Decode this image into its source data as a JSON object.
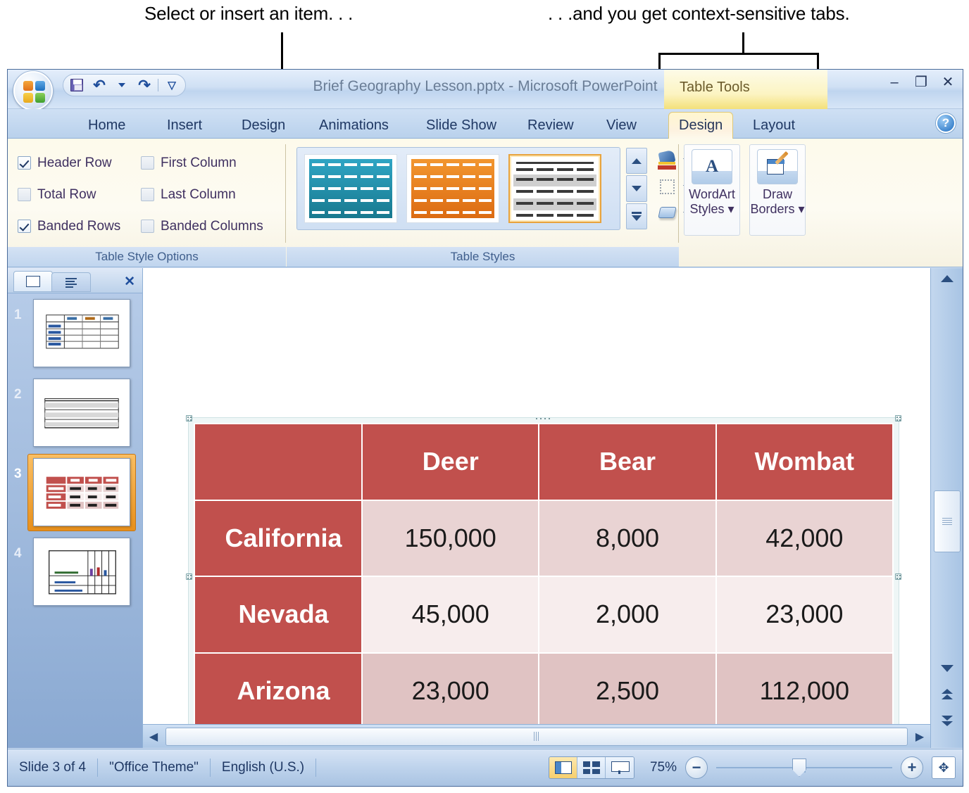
{
  "annotations": {
    "left_callout": "Select or insert an item. . .",
    "right_callout": ". . .and you get context-sensitive tabs."
  },
  "window": {
    "title": "Brief Geography Lesson.pptx - Microsoft PowerPoint",
    "contextual_group_label": "Table Tools",
    "office_button": "office-orb",
    "quick_access": [
      {
        "name": "save",
        "icon": "save-icon"
      },
      {
        "name": "undo",
        "icon": "undo-icon"
      },
      {
        "name": "undo-dropdown",
        "icon": "chevron-down-icon"
      },
      {
        "name": "redo",
        "icon": "redo-icon"
      },
      {
        "name": "customize-qat",
        "icon": "chevron-down-icon"
      }
    ],
    "controls": {
      "minimize": "–",
      "restore": "❐",
      "close": "✕"
    },
    "help": "?"
  },
  "tabs": {
    "main": [
      "Home",
      "Insert",
      "Design",
      "Animations",
      "Slide Show",
      "Review",
      "View"
    ],
    "contextual": [
      "Design",
      "Layout"
    ],
    "active": "Design"
  },
  "ribbon": {
    "groups": [
      {
        "label": "Table Style Options"
      },
      {
        "label": "Table Styles"
      }
    ],
    "table_style_options": [
      {
        "label": "Header Row",
        "checked": true
      },
      {
        "label": "First Column",
        "checked": false
      },
      {
        "label": "Total Row",
        "checked": false
      },
      {
        "label": "Last Column",
        "checked": false
      },
      {
        "label": "Banded Rows",
        "checked": true
      },
      {
        "label": "Banded Columns",
        "checked": false
      }
    ],
    "gallery": {
      "items": [
        {
          "name": "table-style-teal",
          "selected": false
        },
        {
          "name": "table-style-orange",
          "selected": false
        },
        {
          "name": "table-style-plain",
          "selected": true
        }
      ],
      "scroll": [
        "scroll-up",
        "scroll-down",
        "more-styles"
      ]
    },
    "style_commands": [
      {
        "name": "shading",
        "icon": "shading-icon"
      },
      {
        "name": "borders",
        "icon": "borders-icon"
      },
      {
        "name": "effects",
        "icon": "effects-icon"
      }
    ],
    "big_buttons": [
      {
        "line1": "WordArt",
        "line2": "Styles",
        "icon": "wordart-icon",
        "dropdown": true
      },
      {
        "line1": "Draw",
        "line2": "Borders",
        "icon": "draw-borders-icon",
        "dropdown": true
      }
    ]
  },
  "slides_pane": {
    "tabs": [
      {
        "name": "slides-tab",
        "icon": "slide-icon",
        "active": true
      },
      {
        "name": "outline-tab",
        "icon": "outline-icon",
        "active": false
      }
    ],
    "close_label": "✕",
    "thumbnails": [
      {
        "number": "1",
        "current": false
      },
      {
        "number": "2",
        "current": false
      },
      {
        "number": "3",
        "current": true
      },
      {
        "number": "4",
        "current": false
      }
    ]
  },
  "slide": {
    "table": {
      "header": [
        "",
        "Deer",
        "Bear",
        "Wombat"
      ],
      "rows": [
        {
          "label": "California",
          "values": [
            "150,000",
            "8,000",
            "42,000"
          ]
        },
        {
          "label": "Nevada",
          "values": [
            "45,000",
            "2,000",
            "23,000"
          ]
        },
        {
          "label": "Arizona",
          "values": [
            "23,000",
            "2,500",
            "112,000"
          ]
        }
      ],
      "header_fill": "#c1504d",
      "first_column_fill": "#c1504d",
      "band_a_fill": "#e9d3d3",
      "band_b_fill": "#f7eded",
      "band_c_fill": "#e0c3c3",
      "selected": true
    }
  },
  "statusbar": {
    "slide_counter": "Slide 3 of 4",
    "theme": "\"Office Theme\"",
    "language": "English (U.S.)",
    "zoom_level": "75%",
    "view_buttons": [
      {
        "name": "normal-view",
        "active": true
      },
      {
        "name": "slide-sorter-view",
        "active": false
      },
      {
        "name": "slide-show-view",
        "active": false
      }
    ],
    "zoom_out": "−",
    "zoom_in": "+",
    "fit_to_window": "fit-icon"
  }
}
